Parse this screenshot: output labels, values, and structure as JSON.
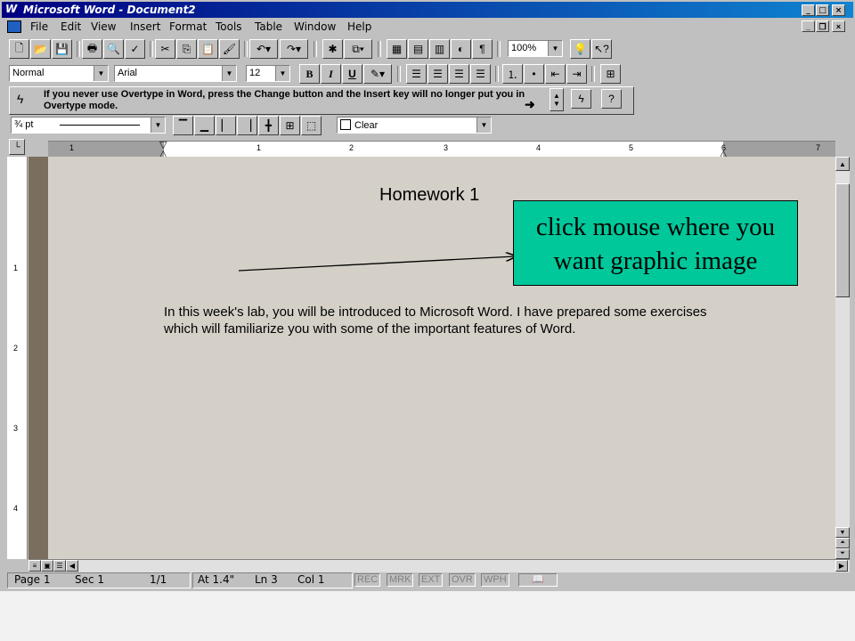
{
  "window": {
    "app_logo": "W",
    "title": "Microsoft Word - Document2"
  },
  "menu": {
    "items": [
      {
        "label": "File"
      },
      {
        "label": "Edit"
      },
      {
        "label": "View"
      },
      {
        "label": "Insert"
      },
      {
        "label": "Format"
      },
      {
        "label": "Tools"
      },
      {
        "label": "Table"
      },
      {
        "label": "Window"
      },
      {
        "label": "Help"
      }
    ]
  },
  "standard_toolbar": {
    "zoom": "100%"
  },
  "format_toolbar": {
    "style": "Normal",
    "font": "Arial",
    "size": "12",
    "bold_label": "B",
    "italic_label": "I",
    "underline_label": "U"
  },
  "tip": {
    "text": "If you never use Overtype in Word, press the Change button and the Insert key will no longer put you in Overtype mode."
  },
  "borders_toolbar": {
    "line_weight": "¾ pt",
    "shading": "Clear"
  },
  "ruler": {
    "numbers": [
      "1",
      "1",
      "2",
      "3",
      "4",
      "5",
      "6",
      "7"
    ],
    "vertical_numbers": [
      "1",
      "2",
      "3",
      "4"
    ]
  },
  "document": {
    "heading": "Homework 1",
    "paragraph": "In this week's lab, you will be introduced to Microsoft Word. I have prepared some exercises which will familiarize you with some of the important features of Word."
  },
  "callout": {
    "line1": "click mouse where you",
    "line2": "want graphic image"
  },
  "status": {
    "page": "Page 1",
    "sec": "Sec 1",
    "pages": "1/1",
    "at": "At 1.4\"",
    "ln": "Ln 3",
    "col": "Col 1",
    "rec": "REC",
    "mrk": "MRK",
    "ext": "EXT",
    "ovr": "OVR",
    "wph": "WPH"
  },
  "colors": {
    "title_bar": "#000080",
    "callout": "#00c89a",
    "document_bg": "#d4d0c8"
  }
}
